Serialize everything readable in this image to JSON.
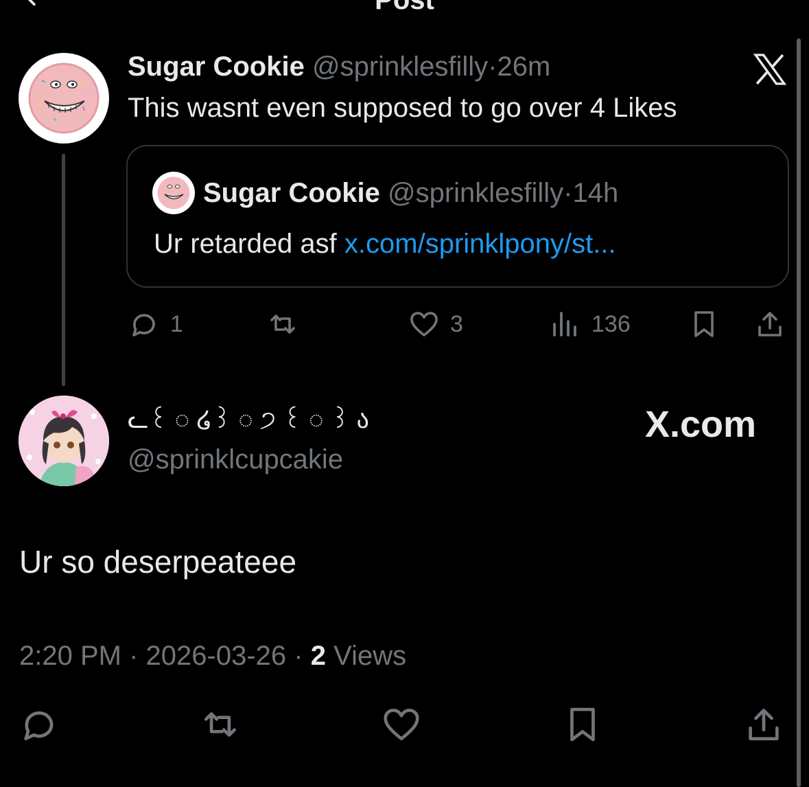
{
  "header": {
    "title": "Post"
  },
  "parent_post": {
    "name": "Sugar Cookie",
    "handle": "@sprinklesfilly",
    "time": "26m",
    "text": "This wasnt even supposed to go over 4 Likes",
    "quote": {
      "name": "Sugar Cookie",
      "handle": "@sprinklesfilly",
      "time": "14h",
      "text": "Ur retarded asf",
      "link": "x.com/sprinklpony/st..."
    },
    "actions": {
      "replies": "1",
      "likes": "3",
      "views": "136"
    }
  },
  "reply": {
    "name": "ᓚ꒰ ◌ ໒꒱ ◌ ੭ ꒰ ◌ ꒱ ა",
    "handle": "@sprinklcupcakie",
    "brand": "X.com",
    "text": "Ur so deserpeateee",
    "time": "2:20 PM",
    "date": "2026-03-26",
    "views_count": "2",
    "views_label": "Views"
  },
  "sep": "·",
  "colors": {
    "background": "#000000",
    "text": "#e7e9ea",
    "muted": "#71767b",
    "link": "#1d9bf0",
    "border": "#2f3336"
  }
}
